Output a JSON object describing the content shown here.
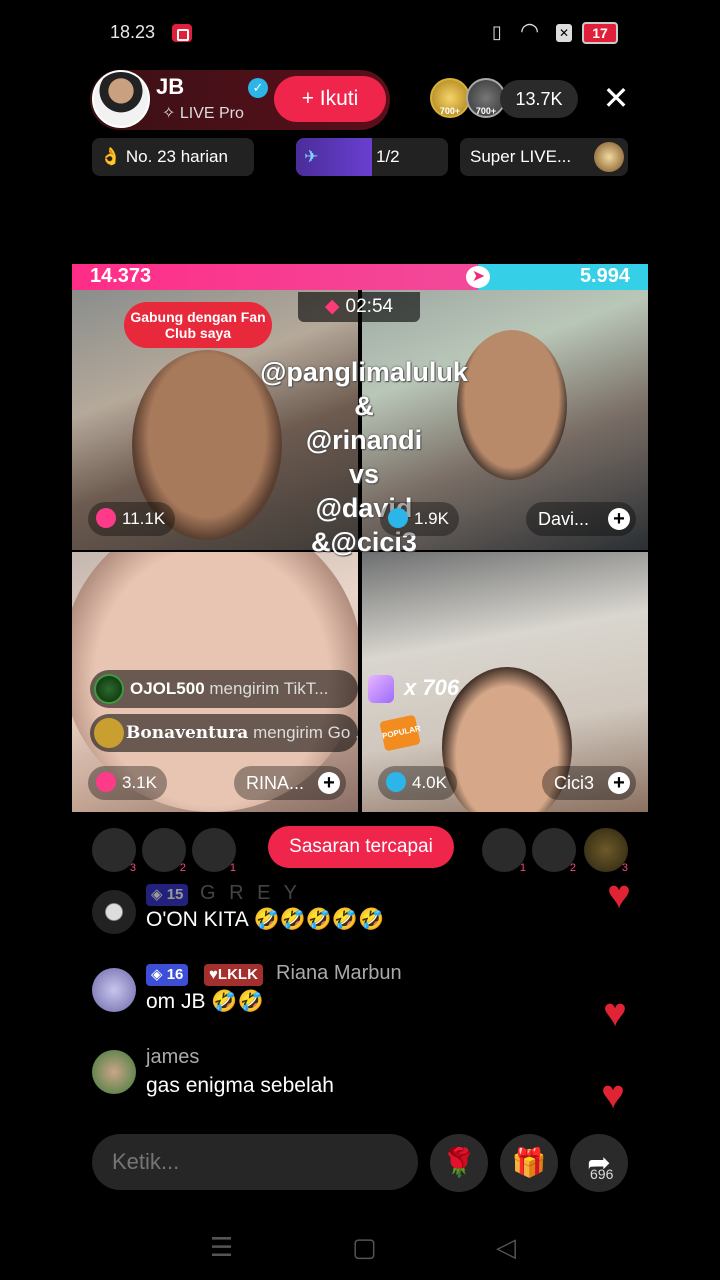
{
  "status": {
    "time": "18.23",
    "battery": "17"
  },
  "host": {
    "name": "JB",
    "subtitle": "LIVE Pro",
    "follow_label": "+ Ikuti"
  },
  "viewers": {
    "badge1": "700+",
    "badge2": "700+",
    "count": "13.7K"
  },
  "pills": {
    "rank": "No. 23 harian",
    "progress": "1/2",
    "progress_value": 0.5,
    "super": "Super LIVE..."
  },
  "battle": {
    "left_score": "14.373",
    "right_score": "5.994",
    "timer": "02:54"
  },
  "fan_club": "Gabung dengan Fan Club saya",
  "overlay_lines": [
    "@panglimaluluk",
    "&",
    "@rinandi",
    "vs",
    "@david",
    "&@cici3"
  ],
  "tiles": [
    {
      "score": "11.1K"
    },
    {
      "score": "1.9K",
      "name": "Davi..."
    },
    {
      "score": "3.1K",
      "name": "RINA..."
    },
    {
      "score": "4.0K",
      "name": "Cici3"
    }
  ],
  "gifts": [
    {
      "user": "OJOL500",
      "action": "mengirim TikT..."
    },
    {
      "user": "Bonaventura",
      "action": "mengirim Go ..."
    }
  ],
  "combo": "x 706",
  "popular_label": "POPULAR",
  "supporters_left": [
    "3",
    "2",
    "1"
  ],
  "supporters_right": [
    "1",
    "2",
    "3"
  ],
  "goal_label": "Sasaran tercapai",
  "comments": [
    {
      "badge": "15",
      "name": "G R E Y",
      "text": "O'ON KITA 🤣🤣🤣🤣🤣"
    },
    {
      "level": "16",
      "club": "LKLK",
      "name": "Riana Marbun",
      "text": "om JB 🤣🤣"
    },
    {
      "name": "james",
      "text": "gas enigma sebelah"
    }
  ],
  "input": {
    "placeholder": "Ketik..."
  },
  "share_count": "696",
  "colors": {
    "accent": "#f0254c",
    "left_team": "#ff2d87",
    "right_team": "#35d0e8"
  }
}
